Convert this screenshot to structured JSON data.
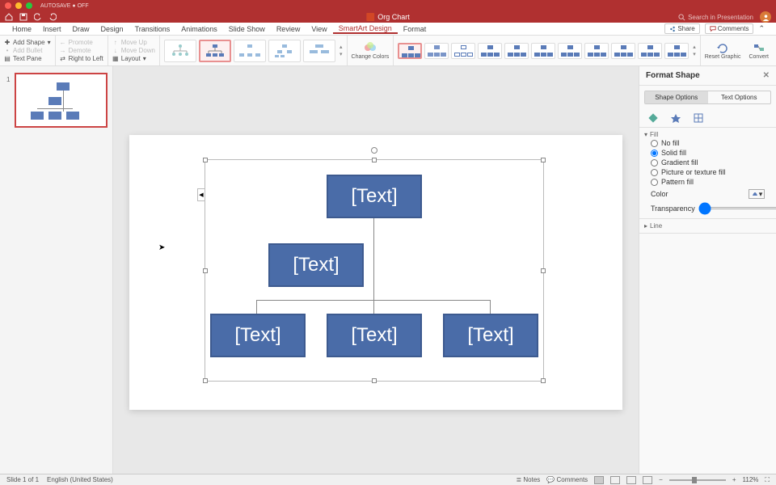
{
  "titlebar": {
    "autosave": "AUTOSAVE ● OFF"
  },
  "qat": {
    "doc_title": "Org Chart",
    "search_placeholder": "Search in Presentation"
  },
  "tabs": {
    "items": [
      "Home",
      "Insert",
      "Draw",
      "Design",
      "Transitions",
      "Animations",
      "Slide Show",
      "Review",
      "View",
      "SmartArt Design",
      "Format"
    ],
    "active": 9,
    "share": "Share",
    "comments": "Comments"
  },
  "ribbon": {
    "add_shape": "Add Shape",
    "add_bullet": "Add Bullet",
    "text_pane": "Text Pane",
    "promote": "Promote",
    "demote": "Demote",
    "right_to_left": "Right to Left",
    "move_up": "Move Up",
    "move_down": "Move Down",
    "layout": "Layout",
    "change_colors": "Change Colors",
    "reset": "Reset Graphic",
    "convert": "Convert"
  },
  "canvas": {
    "nodes": [
      "[Text]",
      "[Text]",
      "[Text]",
      "[Text]",
      "[Text]"
    ]
  },
  "format_pane": {
    "title": "Format Shape",
    "shape_options": "Shape Options",
    "text_options": "Text Options",
    "fill_section": "Fill",
    "no_fill": "No fill",
    "solid_fill": "Solid fill",
    "gradient_fill": "Gradient fill",
    "picture_fill": "Picture or texture fill",
    "pattern_fill": "Pattern fill",
    "color_label": "Color",
    "transparency_label": "Transparency",
    "transparency_value": "0%",
    "line_section": "Line"
  },
  "status": {
    "slide": "Slide 1 of 1",
    "lang": "English (United States)",
    "notes": "Notes",
    "comments": "Comments",
    "zoom": "112%"
  }
}
